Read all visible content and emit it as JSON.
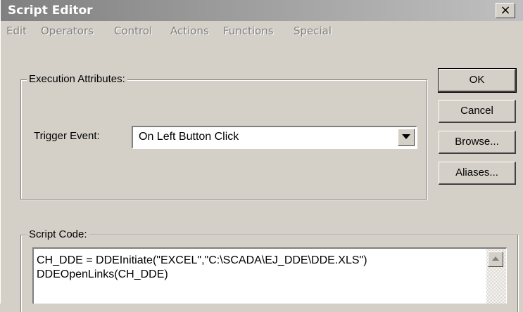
{
  "window": {
    "title": "Script Editor",
    "close_label": "×"
  },
  "menu": {
    "items": [
      "Edit",
      "Operators",
      "Control",
      "Actions",
      "Functions",
      "Special"
    ]
  },
  "execution": {
    "group_label": "Execution Attributes:",
    "trigger_label": "Trigger Event:",
    "trigger_value": "On Left Button Click"
  },
  "buttons": {
    "ok": "OK",
    "cancel": "Cancel",
    "browse": "Browse...",
    "aliases": "Aliases..."
  },
  "script": {
    "group_label": "Script Code:",
    "lines": [
      "CH_DDE = DDEInitiate(\"EXCEL\",\"C:\\SCADA\\EJ_DDE\\DDE.XLS\")",
      "DDEOpenLinks(CH_DDE)"
    ]
  },
  "colors": {
    "face": "#d4d0c8",
    "title_inactive": "#808080",
    "disabled_text": "#808080"
  }
}
